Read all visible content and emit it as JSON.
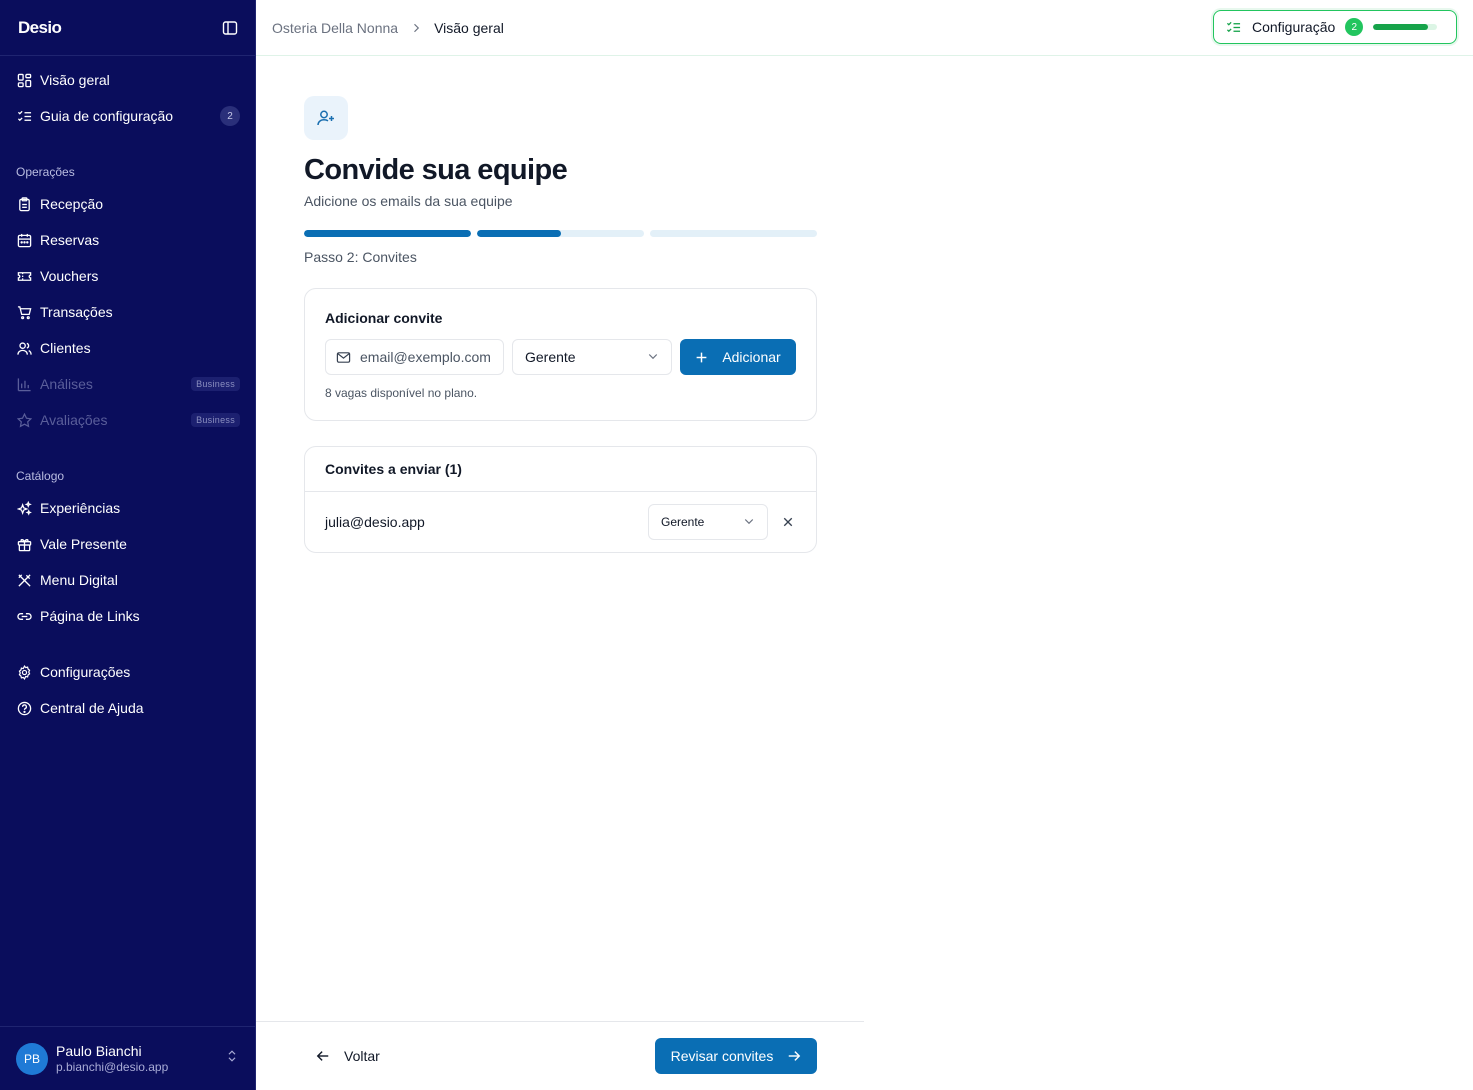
{
  "sidebar": {
    "logo": "Desio",
    "top_items": [
      {
        "label": "Visão geral",
        "icon": "layout-grid-icon"
      },
      {
        "label": "Guia de configuração",
        "icon": "list-checks-icon",
        "badge": "2"
      }
    ],
    "operations_label": "Operações",
    "operations": [
      {
        "label": "Recepção",
        "icon": "clipboard-icon"
      },
      {
        "label": "Reservas",
        "icon": "calendar-icon"
      },
      {
        "label": "Vouchers",
        "icon": "ticket-icon"
      },
      {
        "label": "Transações",
        "icon": "cart-icon"
      },
      {
        "label": "Clientes",
        "icon": "users-icon"
      },
      {
        "label": "Análises",
        "icon": "bar-chart-icon",
        "plan": "Business",
        "disabled": true
      },
      {
        "label": "Avaliações",
        "icon": "star-icon",
        "plan": "Business",
        "disabled": true
      }
    ],
    "catalog_label": "Catálogo",
    "catalog": [
      {
        "label": "Experiências",
        "icon": "sparkles-icon"
      },
      {
        "label": "Vale Presente",
        "icon": "gift-icon"
      },
      {
        "label": "Menu Digital",
        "icon": "utensils-icon"
      },
      {
        "label": "Página de Links",
        "icon": "link-icon"
      }
    ],
    "bottom_items": [
      {
        "label": "Configurações",
        "icon": "gear-icon"
      },
      {
        "label": "Central de Ajuda",
        "icon": "help-circle-icon"
      }
    ],
    "user": {
      "initials": "PB",
      "name": "Paulo Bianchi",
      "email": "p.bianchi@desio.app"
    }
  },
  "header": {
    "breadcrumb": [
      "Osteria Della Nonna",
      "Visão geral"
    ],
    "config": {
      "label": "Configuração",
      "count": "2",
      "progress": 0.85
    }
  },
  "main": {
    "title": "Convide sua equipe",
    "subtitle": "Adicione os emails da sua equipe",
    "steps": [
      1.0,
      0.5,
      0.0
    ],
    "step_label": "Passo 2: Convites",
    "add_card": {
      "title": "Adicionar convite",
      "email_placeholder": "email@exemplo.com",
      "role": "Gerente",
      "add_label": "Adicionar",
      "slots_note": "8 vagas disponível no plano."
    },
    "list_card": {
      "title": "Convites a enviar (1)",
      "invites": [
        {
          "email": "julia@desio.app",
          "role": "Gerente"
        }
      ]
    }
  },
  "footer": {
    "back_label": "Voltar",
    "review_label": "Revisar convites"
  },
  "colors": {
    "sidebar_bg": "#0a0d5c",
    "primary": "#0a6eb4",
    "success": "#22c55e"
  }
}
